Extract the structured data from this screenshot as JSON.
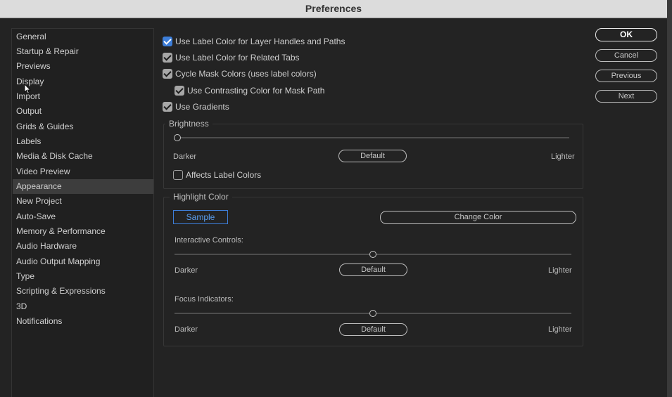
{
  "window": {
    "title": "Preferences"
  },
  "sidebar": {
    "items": [
      {
        "label": "General"
      },
      {
        "label": "Startup & Repair"
      },
      {
        "label": "Previews"
      },
      {
        "label": "Display"
      },
      {
        "label": "Import"
      },
      {
        "label": "Output"
      },
      {
        "label": "Grids & Guides"
      },
      {
        "label": "Labels"
      },
      {
        "label": "Media & Disk Cache"
      },
      {
        "label": "Video Preview"
      },
      {
        "label": "Appearance",
        "selected": true
      },
      {
        "label": "New Project"
      },
      {
        "label": "Auto-Save"
      },
      {
        "label": "Memory & Performance"
      },
      {
        "label": "Audio Hardware"
      },
      {
        "label": "Audio Output Mapping"
      },
      {
        "label": "Type"
      },
      {
        "label": "Scripting & Expressions"
      },
      {
        "label": "3D"
      },
      {
        "label": "Notifications"
      }
    ]
  },
  "options": {
    "label_color_handles": {
      "label": "Use Label Color for Layer Handles and Paths",
      "checked": true
    },
    "label_color_tabs": {
      "label": "Use Label Color for Related Tabs",
      "checked": true
    },
    "cycle_mask_colors": {
      "label": "Cycle Mask Colors (uses label colors)",
      "checked": true
    },
    "contrasting_mask": {
      "label": "Use Contrasting Color for Mask Path",
      "checked": true
    },
    "use_gradients": {
      "label": "Use Gradients",
      "checked": true
    }
  },
  "brightness": {
    "title": "Brightness",
    "level": 0,
    "darker": "Darker",
    "lighter": "Lighter",
    "default_label": "Default",
    "affects_label_colors": {
      "label": "Affects Label Colors",
      "checked": false
    }
  },
  "highlight": {
    "title": "Highlight Color",
    "sample_label": "Sample",
    "change_color_label": "Change Color",
    "interactive": {
      "title": "Interactive Controls:",
      "level": 0.5,
      "darker": "Darker",
      "lighter": "Lighter",
      "default_label": "Default"
    },
    "focus": {
      "title": "Focus Indicators:",
      "level": 0.5,
      "darker": "Darker",
      "lighter": "Lighter",
      "default_label": "Default"
    }
  },
  "buttons": {
    "ok": "OK",
    "cancel": "Cancel",
    "previous": "Previous",
    "next": "Next"
  },
  "colors": {
    "accent": "#3d7ed9",
    "selected_item": "#3d3d3d",
    "background": "#232323"
  }
}
